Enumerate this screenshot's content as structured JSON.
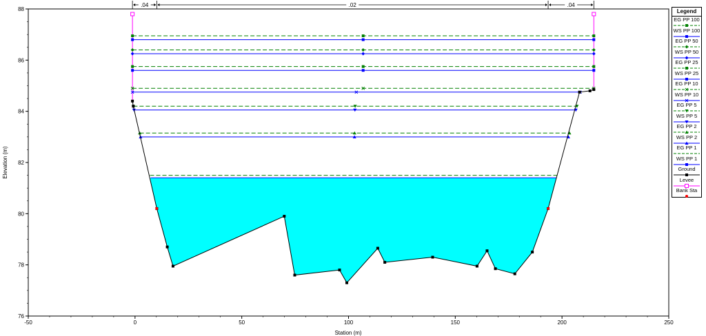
{
  "chart_data": {
    "type": "line",
    "xlabel": "Station (m)",
    "ylabel": "Elevation (m)",
    "xlim": [
      -50,
      250
    ],
    "ylim": [
      76,
      88
    ],
    "xticks": [
      -50,
      0,
      50,
      100,
      150,
      200,
      250
    ],
    "yticks": [
      76,
      78,
      80,
      82,
      84,
      86,
      88
    ],
    "grid": false,
    "legend_position": "right",
    "colors": {
      "ground": "#000000",
      "ws": "#0000ff",
      "eg": "#008000",
      "levee": "#ff00ff",
      "bank": "#ff0000",
      "water_fill": "#00ffff"
    },
    "ground": {
      "x": [
        -1.2,
        -0.8,
        10.2,
        15.1,
        17.8,
        69.9,
        74.8,
        95.8,
        99.2,
        113.7,
        117.0,
        139.4,
        160.2,
        164.9,
        168.8,
        177.9,
        186.1,
        193.5,
        208.2,
        213.1,
        214.9
      ],
      "y": [
        84.4,
        84.2,
        80.2,
        78.7,
        77.95,
        79.9,
        77.6,
        77.8,
        77.3,
        78.65,
        78.1,
        78.3,
        77.95,
        78.55,
        77.85,
        77.65,
        78.5,
        80.2,
        84.75,
        84.8,
        84.85
      ]
    },
    "bank_stations": [
      {
        "x": 10.2,
        "y": 80.2
      },
      {
        "x": 193.5,
        "y": 80.2
      }
    ],
    "levees": [
      {
        "x": -1.2,
        "top": 87.8
      },
      {
        "x": 214.9,
        "top": 87.8
      }
    ],
    "n_values": {
      "labels": [
        ".04",
        ".02",
        ".04"
      ],
      "boundaries": [
        -1.2,
        10.2,
        193.5,
        214.9
      ]
    },
    "series": [
      {
        "name": "EG PP 100",
        "kind": "eg",
        "elev": 86.95,
        "x": [
          -1.2,
          214.9
        ],
        "marker": "square"
      },
      {
        "name": "WS PP 100",
        "kind": "ws",
        "elev": 86.8,
        "x": [
          -1.2,
          214.9
        ],
        "marker": "square"
      },
      {
        "name": "EG PP 50",
        "kind": "eg",
        "elev": 86.4,
        "x": [
          -1.2,
          214.9
        ],
        "marker": "diamond"
      },
      {
        "name": "WS PP 50",
        "kind": "ws",
        "elev": 86.25,
        "x": [
          -1.2,
          214.9
        ],
        "marker": "diamond"
      },
      {
        "name": "EG PP 25",
        "kind": "eg",
        "elev": 85.75,
        "x": [
          -1.2,
          214.9
        ],
        "marker": "square"
      },
      {
        "name": "WS PP 25",
        "kind": "ws",
        "elev": 85.6,
        "x": [
          -1.2,
          214.9
        ],
        "marker": "square"
      },
      {
        "name": "EG PP 10",
        "kind": "eg",
        "elev": 84.9,
        "x": [
          -1.2,
          214.9
        ],
        "marker": "cross"
      },
      {
        "name": "WS PP 10",
        "kind": "ws",
        "elev": 84.75,
        "x": [
          -1.2,
          208.5
        ],
        "marker": "cross"
      },
      {
        "name": "EG PP 5",
        "kind": "eg",
        "elev": 84.2,
        "x": [
          -0.8,
          207.0
        ],
        "marker": "tri-down"
      },
      {
        "name": "WS PP 5",
        "kind": "ws",
        "elev": 84.05,
        "x": [
          -0.5,
          206.5
        ],
        "marker": "tri-down"
      },
      {
        "name": "EG PP 2",
        "kind": "eg",
        "elev": 83.15,
        "x": [
          2.2,
          203.5
        ],
        "marker": "tri-up"
      },
      {
        "name": "WS PP 2",
        "kind": "ws",
        "elev": 83.0,
        "x": [
          2.6,
          203.0
        ],
        "marker": "tri-up"
      },
      {
        "name": "EG PP 1",
        "kind": "eg",
        "elev": 81.5,
        "x": [
          7.0,
          198.0
        ],
        "marker": "none"
      },
      {
        "name": "WS PP 1",
        "kind": "ws",
        "elev": 81.4,
        "x": [
          7.4,
          197.5
        ],
        "marker": "none"
      }
    ],
    "legend": {
      "title": "Legend",
      "items": [
        {
          "label": "EG PP 100",
          "kind": "eg",
          "marker": "square"
        },
        {
          "label": "WS PP 100",
          "kind": "ws",
          "marker": "square"
        },
        {
          "label": "EG PP 50",
          "kind": "eg",
          "marker": "diamond"
        },
        {
          "label": "WS PP 50",
          "kind": "ws",
          "marker": "diamond"
        },
        {
          "label": "EG PP 25",
          "kind": "eg",
          "marker": "square"
        },
        {
          "label": "WS PP 25",
          "kind": "ws",
          "marker": "square"
        },
        {
          "label": "EG PP 10",
          "kind": "eg",
          "marker": "cross"
        },
        {
          "label": "WS PP 10",
          "kind": "ws",
          "marker": "cross"
        },
        {
          "label": "EG PP 5",
          "kind": "eg",
          "marker": "tri-down"
        },
        {
          "label": "WS PP 5",
          "kind": "ws",
          "marker": "tri-down"
        },
        {
          "label": "EG PP 2",
          "kind": "eg",
          "marker": "tri-up"
        },
        {
          "label": "WS PP 2",
          "kind": "ws",
          "marker": "tri-up"
        },
        {
          "label": "EG PP 1",
          "kind": "eg",
          "marker": "none"
        },
        {
          "label": "WS PP 1",
          "kind": "ws",
          "marker": "square"
        },
        {
          "label": "Ground",
          "kind": "ground",
          "marker": "square"
        },
        {
          "label": "Levee",
          "kind": "levee",
          "marker": "open-square"
        },
        {
          "label": "Bank Sta",
          "kind": "bank",
          "marker": "dot"
        }
      ]
    }
  }
}
